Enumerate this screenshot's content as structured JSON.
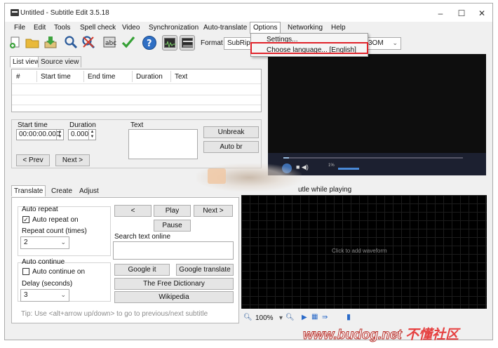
{
  "window": {
    "title": "Untitled - Subtitle Edit 3.5.18",
    "minimize": "–",
    "maximize": "☐",
    "close": "✕"
  },
  "menu": {
    "items": [
      "File",
      "Edit",
      "Tools",
      "Spell check",
      "Video",
      "Synchronization",
      "Auto-translate",
      "Options",
      "Networking",
      "Help"
    ],
    "options_dropdown": [
      "Settings...",
      "Choose language... [English]"
    ]
  },
  "toolbar": {
    "format_label": "Format",
    "format_value": "SubRip",
    "encoding_value": "3OM",
    "icons": [
      "new-icon",
      "open-icon",
      "save-icon",
      "find-icon",
      "replace-icon",
      "fix-icon",
      "spellcheck-icon",
      "help-icon",
      "waveform-icon",
      "video-icon"
    ]
  },
  "list_tabs": [
    "List view",
    "Source view"
  ],
  "grid": {
    "columns": [
      "#",
      "Start time",
      "End time",
      "Duration",
      "Text"
    ]
  },
  "editor": {
    "start_time_label": "Start time",
    "start_time_value": "00:00:00.000",
    "duration_label": "Duration",
    "duration_value": "0.000",
    "text_label": "Text",
    "unbreak": "Unbreak",
    "auto_br": "Auto br",
    "prev": "< Prev",
    "next": "Next >"
  },
  "video": {
    "stop_fragment": "utle while playing",
    "volume_text": "1%"
  },
  "bottom_tabs": [
    "Translate",
    "Create",
    "Adjust"
  ],
  "translate": {
    "auto_repeat_group": "Auto repeat",
    "auto_repeat_on": "Auto repeat on",
    "auto_repeat_checked": true,
    "repeat_count_label": "Repeat count (times)",
    "repeat_count_value": "2",
    "auto_continue_group": "Auto continue",
    "auto_continue_on": "Auto continue on",
    "auto_continue_checked": false,
    "delay_label": "Delay (seconds)",
    "delay_value": "3",
    "prev_btn": "<",
    "play_btn": "Play",
    "next_btn": "Next >",
    "pause_btn": "Pause",
    "search_label": "Search text online",
    "google_it": "Google it",
    "google_translate": "Google translate",
    "free_dictionary": "The Free Dictionary",
    "wikipedia": "Wikipedia",
    "tip": "Tip: Use <alt+arrow up/down> to go to previous/next subtitle"
  },
  "waveform": {
    "placeholder": "Click to add waveform",
    "zoom": "100%"
  },
  "watermark": {
    "site": "www.budog.net",
    "brand": "不懂社区"
  },
  "colors": {
    "highlight_box": "#e0232a",
    "window_bg": "#f0f0f0",
    "video_bg": "#0e0e0e"
  }
}
